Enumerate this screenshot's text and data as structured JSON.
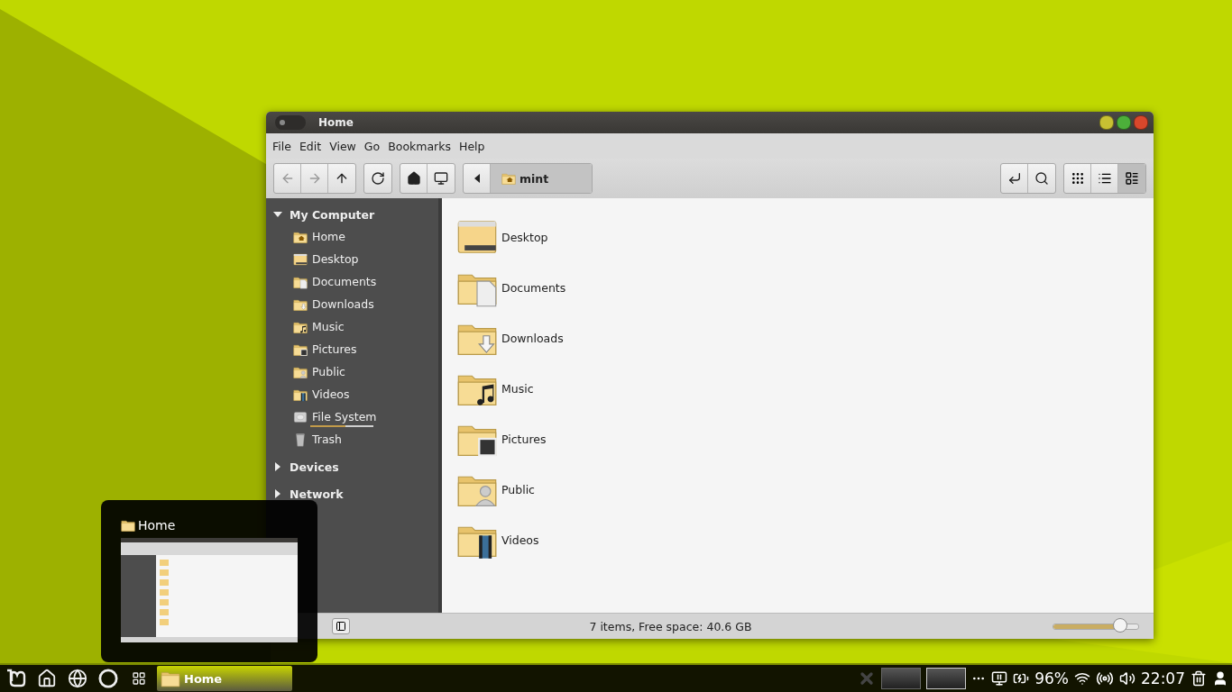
{
  "window": {
    "title": "Home",
    "switch": {
      "on": false
    },
    "menu": [
      "File",
      "Edit",
      "View",
      "Go",
      "Bookmarks",
      "Help"
    ]
  },
  "toolbar": {
    "path": [
      {
        "label": "mint",
        "kind": "home",
        "selected": true
      }
    ],
    "view_modes": [
      {
        "kind": "icons",
        "selected": false
      },
      {
        "kind": "list",
        "selected": false
      },
      {
        "kind": "compact",
        "selected": true
      }
    ]
  },
  "sidebar": {
    "sections": [
      {
        "title": "My Computer",
        "expanded": true,
        "items": [
          {
            "label": "Home",
            "kind": "home"
          },
          {
            "label": "Desktop",
            "kind": "desktop"
          },
          {
            "label": "Documents",
            "kind": "documents"
          },
          {
            "label": "Downloads",
            "kind": "downloads"
          },
          {
            "label": "Music",
            "kind": "music"
          },
          {
            "label": "Pictures",
            "kind": "pictures"
          },
          {
            "label": "Public",
            "kind": "public"
          },
          {
            "label": "Videos",
            "kind": "videos"
          },
          {
            "label": "File System",
            "kind": "filesystem",
            "level": 0.55
          },
          {
            "label": "Trash",
            "kind": "trash"
          }
        ]
      },
      {
        "title": "Devices",
        "expanded": false
      },
      {
        "title": "Network",
        "expanded": false
      }
    ]
  },
  "files": [
    {
      "label": "Desktop",
      "kind": "desktop"
    },
    {
      "label": "Documents",
      "kind": "documents"
    },
    {
      "label": "Downloads",
      "kind": "downloads"
    },
    {
      "label": "Music",
      "kind": "music"
    },
    {
      "label": "Pictures",
      "kind": "pictures"
    },
    {
      "label": "Public",
      "kind": "public"
    },
    {
      "label": "Videos",
      "kind": "videos"
    }
  ],
  "status_bar": {
    "text": "7 items, Free space: 40.6 GB",
    "zoom": {
      "level": 0.8
    }
  },
  "preview": {
    "title": "Home"
  },
  "taskbar": {
    "window_buttons": [
      {
        "label": "Home",
        "selected": true
      }
    ],
    "battery": "96%",
    "clock": "22:07"
  }
}
